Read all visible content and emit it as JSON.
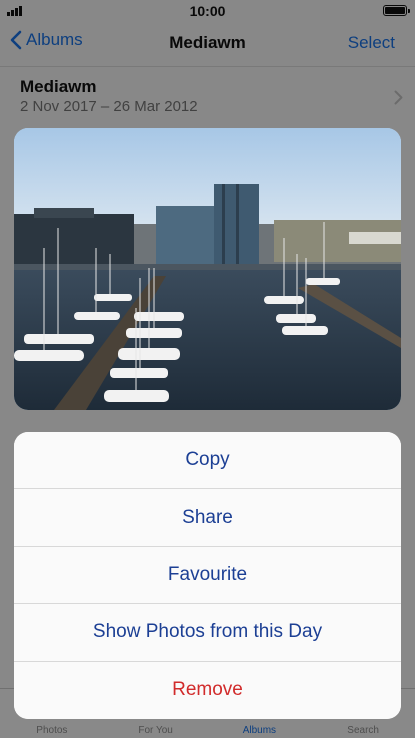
{
  "status_bar": {
    "time": "10:00"
  },
  "nav": {
    "back_label": "Albums",
    "title": "Mediawm",
    "select_label": "Select"
  },
  "album": {
    "name": "Mediawm",
    "dates": "2 Nov 2017 – 26 Mar 2012"
  },
  "tabs": [
    {
      "label": "Photos",
      "icon": "photos-icon"
    },
    {
      "label": "For You",
      "icon": "for-you-icon"
    },
    {
      "label": "Albums",
      "icon": "albums-icon",
      "active": true
    },
    {
      "label": "Search",
      "icon": "search-icon"
    }
  ],
  "preview": {
    "icon": "harbour-photo"
  },
  "actions": [
    {
      "label": "Copy"
    },
    {
      "label": "Share"
    },
    {
      "label": "Favourite"
    },
    {
      "label": "Show Photos from this Day"
    },
    {
      "label": "Remove",
      "destructive": true
    }
  ],
  "colors": {
    "accent": "#1a73e8",
    "destructive": "#d12b2b",
    "action_text": "#1c3f94"
  }
}
